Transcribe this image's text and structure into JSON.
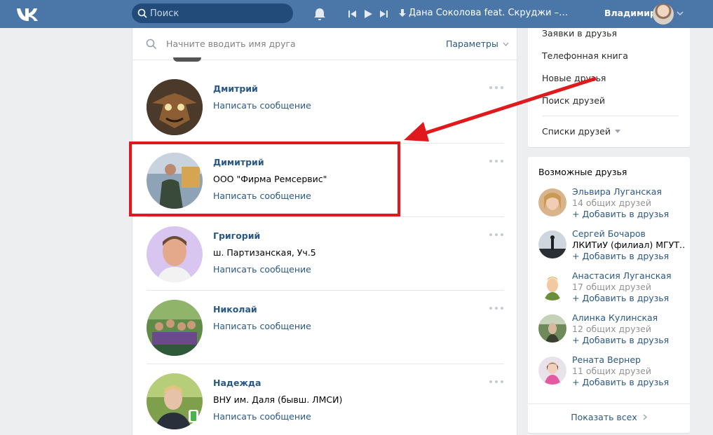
{
  "header": {
    "search_placeholder": "Поиск",
    "track": "Дана Соколова feat. Скруджи –…",
    "user_name": "Владимир"
  },
  "friends": {
    "search_label": "Начните вводить имя друга",
    "params_label": "Параметры",
    "rows": [
      {
        "name": "Дмитрий",
        "sub": "",
        "msg": "Написать сообщение"
      },
      {
        "name": "Димитрий",
        "sub": "ООО \"Фирма Ремсервис\"",
        "msg": "Написать сообщение"
      },
      {
        "name": "Григорий",
        "sub": "ш. Партизанская, Уч.5",
        "msg": "Написать сообщение"
      },
      {
        "name": "Николай",
        "sub": "",
        "msg": "Написать сообщение"
      },
      {
        "name": "Надежда",
        "sub": "ВНУ им. Даля (бывш. ЛМСИ)",
        "msg": "Написать сообщение"
      }
    ]
  },
  "menu": {
    "items": [
      "Заявки в друзья",
      "Телефонная книга",
      "Новые друзья",
      "Поиск друзей"
    ],
    "lists_label": "Списки друзей"
  },
  "possible_friends": {
    "title": "Возможные друзья",
    "items": [
      {
        "name": "Эльвира Луганская",
        "mutual": "14 общих друзей",
        "add": "Добавить в друзья"
      },
      {
        "name": "Сергей Бочаров",
        "mutual": "ЛКИТиУ (филиал) МГУТ…",
        "add": "Добавить в друзья"
      },
      {
        "name": "Анастасия Луганская",
        "mutual": "17 общих друзей",
        "add": "Добавить в друзья"
      },
      {
        "name": "Алинка Кулинская",
        "mutual": "12 общих друзей",
        "add": "Добавить в друзья"
      },
      {
        "name": "Рената Вернер",
        "mutual": "11 общих друзей",
        "add": "Добавить в друзья"
      }
    ],
    "show_all": "Показать всех"
  },
  "colors": {
    "header": "#4a76a8",
    "link": "#2a5885",
    "highlight": "#e0191d"
  },
  "icons": [
    "vk-logo-icon",
    "search-icon",
    "bell-icon",
    "prev-icon",
    "play-icon",
    "next-icon",
    "download-icon",
    "chevron-down-icon",
    "more-dots-icon",
    "mobile-online-icon",
    "plus-icon",
    "chevron-right-icon",
    "red-arrow-icon"
  ]
}
